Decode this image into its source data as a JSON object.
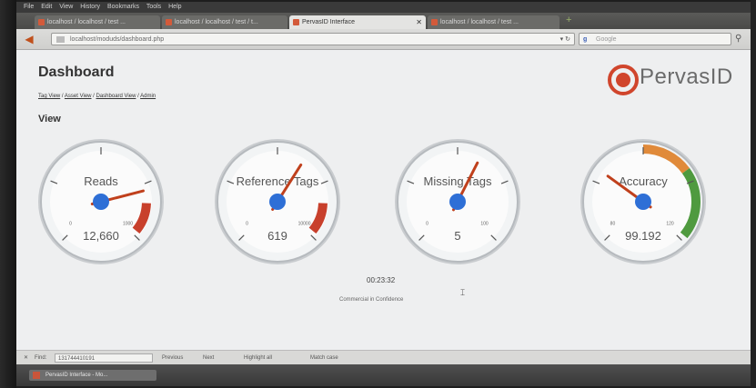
{
  "browser": {
    "menu": [
      "File",
      "Edit",
      "View",
      "History",
      "Bookmarks",
      "Tools",
      "Help"
    ],
    "tabs": [
      {
        "label": "localhost / localhost / test ..."
      },
      {
        "label": "localhost / localhost / test / t..."
      },
      {
        "label": "PervasID Interface"
      },
      {
        "label": "localhost / localhost / test ..."
      }
    ],
    "url": "localhost/moduds/dashboard.php",
    "search_placeholder": "Google"
  },
  "page": {
    "title": "Dashboard",
    "breadcrumbs": [
      "Tag View",
      "Asset View",
      "Dashboard View",
      "Admin"
    ],
    "section": "View",
    "logo_text": "PervasID",
    "timer": "00:23:32",
    "footnote": "Commercial in Confidence"
  },
  "gauges": [
    {
      "label": "Reads",
      "value": "12,660",
      "min": "0",
      "max": "1000",
      "fraction": 0.78,
      "zone": "red"
    },
    {
      "label": "Reference Tags",
      "value": "619",
      "min": "0",
      "max": "10000",
      "fraction": 0.62,
      "zone": "red"
    },
    {
      "label": "Missing Tags",
      "value": "5",
      "min": "0",
      "max": "100",
      "fraction": 0.6,
      "zone": "none"
    },
    {
      "label": "Accuracy",
      "value": "99.192",
      "min": "80",
      "max": "120",
      "fraction": 0.3,
      "zone": "orange-green"
    }
  ],
  "colors": {
    "red_zone": "#c8402c",
    "orange_zone": "#e08a3a",
    "green_zone": "#4f9a3f",
    "needle": "#c0401c",
    "hub": "#2e6fd6"
  },
  "statusbar": {
    "find_label": "Find:",
    "find_value": "131744410191",
    "prev": "Previous",
    "next": "Next",
    "highlight": "Highlight all",
    "match_case": "Match case"
  },
  "taskbar": {
    "item": "PervasID Interface - Mo..."
  }
}
